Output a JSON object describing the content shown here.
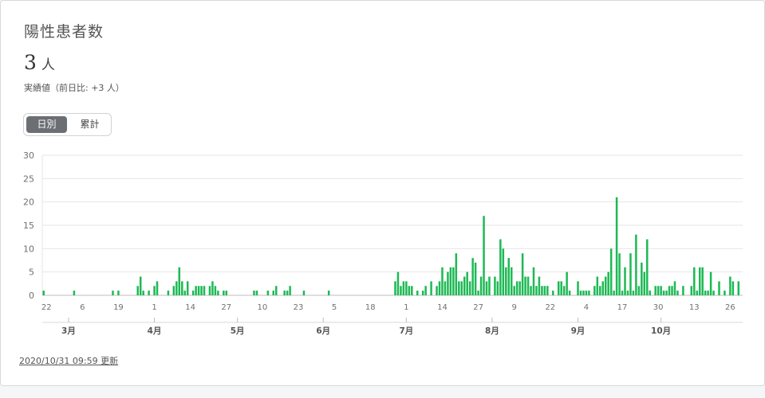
{
  "title": "陽性患者数",
  "value": "3",
  "unit": "人",
  "subtext": "実績値（前日比: +3 人）",
  "toggle": {
    "daily": "日別",
    "cumulative": "累計"
  },
  "updated": "2020/10/31 09:59 更新",
  "colors": {
    "bar": "#1db954",
    "grid": "#e6e6e6",
    "axis": "#cccccc",
    "text": "#707070"
  },
  "chart_data": {
    "type": "bar",
    "title": "",
    "xlabel": "",
    "ylabel": "",
    "ylim": [
      0,
      30
    ],
    "yticks": [
      0,
      5,
      10,
      15,
      20,
      25,
      30
    ],
    "start_date": "2020-02-21",
    "end_date": "2020-10-30",
    "grid": true,
    "day_ticks": [
      {
        "date": "2020-02-22",
        "label": "22"
      },
      {
        "date": "2020-03-06",
        "label": "6"
      },
      {
        "date": "2020-03-19",
        "label": "19"
      },
      {
        "date": "2020-04-01",
        "label": "1"
      },
      {
        "date": "2020-04-14",
        "label": "14"
      },
      {
        "date": "2020-04-27",
        "label": "27"
      },
      {
        "date": "2020-05-10",
        "label": "10"
      },
      {
        "date": "2020-05-23",
        "label": "23"
      },
      {
        "date": "2020-06-05",
        "label": "5"
      },
      {
        "date": "2020-06-18",
        "label": "18"
      },
      {
        "date": "2020-07-01",
        "label": "1"
      },
      {
        "date": "2020-07-14",
        "label": "14"
      },
      {
        "date": "2020-07-27",
        "label": "27"
      },
      {
        "date": "2020-08-09",
        "label": "9"
      },
      {
        "date": "2020-08-22",
        "label": "22"
      },
      {
        "date": "2020-09-04",
        "label": "4"
      },
      {
        "date": "2020-09-17",
        "label": "17"
      },
      {
        "date": "2020-09-30",
        "label": "30"
      },
      {
        "date": "2020-10-13",
        "label": "13"
      },
      {
        "date": "2020-10-26",
        "label": "26"
      }
    ],
    "month_ticks": [
      {
        "date": "2020-03-01",
        "label": "3月"
      },
      {
        "date": "2020-04-01",
        "label": "4月"
      },
      {
        "date": "2020-05-01",
        "label": "5月"
      },
      {
        "date": "2020-06-01",
        "label": "6月"
      },
      {
        "date": "2020-07-01",
        "label": "7月"
      },
      {
        "date": "2020-08-01",
        "label": "8月"
      },
      {
        "date": "2020-09-01",
        "label": "9月"
      },
      {
        "date": "2020-10-01",
        "label": "10月"
      }
    ],
    "series": [
      {
        "values": [
          {
            "date": "2020-02-21",
            "value": 1
          },
          {
            "date": "2020-03-03",
            "value": 1
          },
          {
            "date": "2020-03-17",
            "value": 1
          },
          {
            "date": "2020-03-19",
            "value": 1
          },
          {
            "date": "2020-03-26",
            "value": 2
          },
          {
            "date": "2020-03-27",
            "value": 4
          },
          {
            "date": "2020-03-28",
            "value": 1
          },
          {
            "date": "2020-03-30",
            "value": 1
          },
          {
            "date": "2020-04-01",
            "value": 2
          },
          {
            "date": "2020-04-02",
            "value": 3
          },
          {
            "date": "2020-04-06",
            "value": 1
          },
          {
            "date": "2020-04-08",
            "value": 2
          },
          {
            "date": "2020-04-09",
            "value": 3
          },
          {
            "date": "2020-04-10",
            "value": 6
          },
          {
            "date": "2020-04-11",
            "value": 3
          },
          {
            "date": "2020-04-12",
            "value": 1
          },
          {
            "date": "2020-04-13",
            "value": 3
          },
          {
            "date": "2020-04-15",
            "value": 1
          },
          {
            "date": "2020-04-16",
            "value": 2
          },
          {
            "date": "2020-04-17",
            "value": 2
          },
          {
            "date": "2020-04-18",
            "value": 2
          },
          {
            "date": "2020-04-19",
            "value": 2
          },
          {
            "date": "2020-04-21",
            "value": 2
          },
          {
            "date": "2020-04-22",
            "value": 3
          },
          {
            "date": "2020-04-23",
            "value": 2
          },
          {
            "date": "2020-04-24",
            "value": 1
          },
          {
            "date": "2020-04-26",
            "value": 1
          },
          {
            "date": "2020-04-27",
            "value": 1
          },
          {
            "date": "2020-05-07",
            "value": 1
          },
          {
            "date": "2020-05-08",
            "value": 1
          },
          {
            "date": "2020-05-12",
            "value": 1
          },
          {
            "date": "2020-05-14",
            "value": 1
          },
          {
            "date": "2020-05-15",
            "value": 2
          },
          {
            "date": "2020-05-18",
            "value": 1
          },
          {
            "date": "2020-05-19",
            "value": 1
          },
          {
            "date": "2020-05-20",
            "value": 2
          },
          {
            "date": "2020-05-25",
            "value": 1
          },
          {
            "date": "2020-06-03",
            "value": 1
          },
          {
            "date": "2020-06-27",
            "value": 3
          },
          {
            "date": "2020-06-28",
            "value": 5
          },
          {
            "date": "2020-06-29",
            "value": 2
          },
          {
            "date": "2020-06-30",
            "value": 3
          },
          {
            "date": "2020-07-01",
            "value": 3
          },
          {
            "date": "2020-07-02",
            "value": 2
          },
          {
            "date": "2020-07-03",
            "value": 2
          },
          {
            "date": "2020-07-05",
            "value": 1
          },
          {
            "date": "2020-07-07",
            "value": 1
          },
          {
            "date": "2020-07-08",
            "value": 2
          },
          {
            "date": "2020-07-10",
            "value": 3
          },
          {
            "date": "2020-07-12",
            "value": 2
          },
          {
            "date": "2020-07-13",
            "value": 3
          },
          {
            "date": "2020-07-14",
            "value": 6
          },
          {
            "date": "2020-07-15",
            "value": 3
          },
          {
            "date": "2020-07-16",
            "value": 5
          },
          {
            "date": "2020-07-17",
            "value": 6
          },
          {
            "date": "2020-07-18",
            "value": 6
          },
          {
            "date": "2020-07-19",
            "value": 9
          },
          {
            "date": "2020-07-20",
            "value": 3
          },
          {
            "date": "2020-07-21",
            "value": 3
          },
          {
            "date": "2020-07-22",
            "value": 4
          },
          {
            "date": "2020-07-23",
            "value": 5
          },
          {
            "date": "2020-07-24",
            "value": 3
          },
          {
            "date": "2020-07-25",
            "value": 8
          },
          {
            "date": "2020-07-26",
            "value": 7
          },
          {
            "date": "2020-07-27",
            "value": 1
          },
          {
            "date": "2020-07-28",
            "value": 4
          },
          {
            "date": "2020-07-29",
            "value": 17
          },
          {
            "date": "2020-07-30",
            "value": 3
          },
          {
            "date": "2020-07-31",
            "value": 4
          },
          {
            "date": "2020-08-02",
            "value": 4
          },
          {
            "date": "2020-08-03",
            "value": 3
          },
          {
            "date": "2020-08-04",
            "value": 12
          },
          {
            "date": "2020-08-05",
            "value": 10
          },
          {
            "date": "2020-08-06",
            "value": 6
          },
          {
            "date": "2020-08-07",
            "value": 8
          },
          {
            "date": "2020-08-08",
            "value": 6
          },
          {
            "date": "2020-08-09",
            "value": 2
          },
          {
            "date": "2020-08-10",
            "value": 3
          },
          {
            "date": "2020-08-11",
            "value": 3
          },
          {
            "date": "2020-08-12",
            "value": 9
          },
          {
            "date": "2020-08-13",
            "value": 4
          },
          {
            "date": "2020-08-14",
            "value": 4
          },
          {
            "date": "2020-08-15",
            "value": 2
          },
          {
            "date": "2020-08-16",
            "value": 6
          },
          {
            "date": "2020-08-17",
            "value": 2
          },
          {
            "date": "2020-08-18",
            "value": 4
          },
          {
            "date": "2020-08-19",
            "value": 2
          },
          {
            "date": "2020-08-20",
            "value": 2
          },
          {
            "date": "2020-08-21",
            "value": 2
          },
          {
            "date": "2020-08-23",
            "value": 1
          },
          {
            "date": "2020-08-25",
            "value": 3
          },
          {
            "date": "2020-08-26",
            "value": 3
          },
          {
            "date": "2020-08-27",
            "value": 2
          },
          {
            "date": "2020-08-28",
            "value": 5
          },
          {
            "date": "2020-08-29",
            "value": 1
          },
          {
            "date": "2020-09-01",
            "value": 3
          },
          {
            "date": "2020-09-02",
            "value": 1
          },
          {
            "date": "2020-09-03",
            "value": 1
          },
          {
            "date": "2020-09-04",
            "value": 1
          },
          {
            "date": "2020-09-05",
            "value": 1
          },
          {
            "date": "2020-09-07",
            "value": 2
          },
          {
            "date": "2020-09-08",
            "value": 4
          },
          {
            "date": "2020-09-09",
            "value": 2
          },
          {
            "date": "2020-09-10",
            "value": 3
          },
          {
            "date": "2020-09-11",
            "value": 4
          },
          {
            "date": "2020-09-12",
            "value": 5
          },
          {
            "date": "2020-09-13",
            "value": 10
          },
          {
            "date": "2020-09-14",
            "value": 1
          },
          {
            "date": "2020-09-15",
            "value": 21
          },
          {
            "date": "2020-09-16",
            "value": 9
          },
          {
            "date": "2020-09-17",
            "value": 1
          },
          {
            "date": "2020-09-18",
            "value": 6
          },
          {
            "date": "2020-09-19",
            "value": 1
          },
          {
            "date": "2020-09-20",
            "value": 9
          },
          {
            "date": "2020-09-21",
            "value": 1
          },
          {
            "date": "2020-09-22",
            "value": 13
          },
          {
            "date": "2020-09-23",
            "value": 2
          },
          {
            "date": "2020-09-24",
            "value": 7
          },
          {
            "date": "2020-09-25",
            "value": 5
          },
          {
            "date": "2020-09-26",
            "value": 12
          },
          {
            "date": "2020-09-27",
            "value": 1
          },
          {
            "date": "2020-09-29",
            "value": 2
          },
          {
            "date": "2020-09-30",
            "value": 2
          },
          {
            "date": "2020-10-01",
            "value": 2
          },
          {
            "date": "2020-10-02",
            "value": 1
          },
          {
            "date": "2020-10-03",
            "value": 1
          },
          {
            "date": "2020-10-04",
            "value": 2
          },
          {
            "date": "2020-10-05",
            "value": 2
          },
          {
            "date": "2020-10-06",
            "value": 3
          },
          {
            "date": "2020-10-07",
            "value": 1
          },
          {
            "date": "2020-10-09",
            "value": 2
          },
          {
            "date": "2020-10-12",
            "value": 2
          },
          {
            "date": "2020-10-13",
            "value": 6
          },
          {
            "date": "2020-10-14",
            "value": 1
          },
          {
            "date": "2020-10-15",
            "value": 6
          },
          {
            "date": "2020-10-16",
            "value": 6
          },
          {
            "date": "2020-10-17",
            "value": 1
          },
          {
            "date": "2020-10-18",
            "value": 1
          },
          {
            "date": "2020-10-19",
            "value": 5
          },
          {
            "date": "2020-10-20",
            "value": 1
          },
          {
            "date": "2020-10-22",
            "value": 3
          },
          {
            "date": "2020-10-24",
            "value": 1
          },
          {
            "date": "2020-10-26",
            "value": 4
          },
          {
            "date": "2020-10-27",
            "value": 3
          },
          {
            "date": "2020-10-29",
            "value": 3
          }
        ]
      }
    ]
  }
}
